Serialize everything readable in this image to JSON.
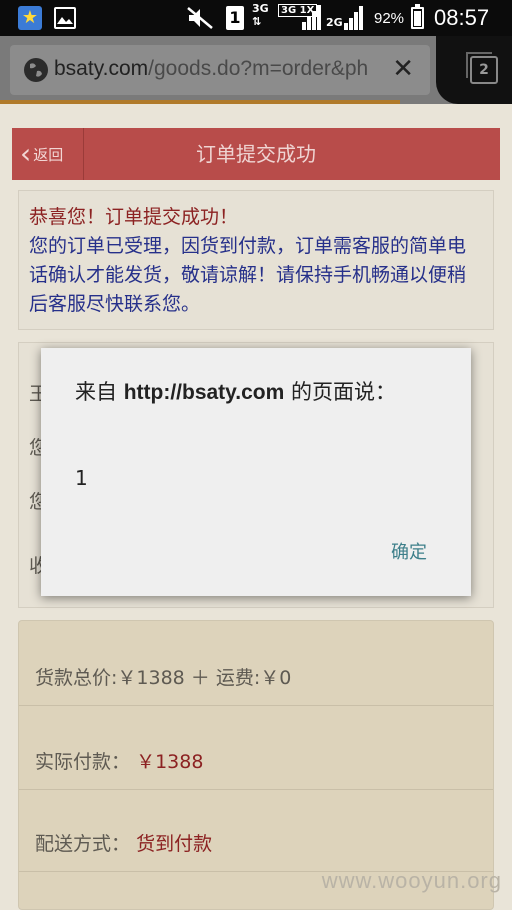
{
  "status_bar": {
    "sim_slot": "1",
    "network_3g": "3G",
    "network_3g_1x": "3G 1X",
    "network_2g": "2G",
    "battery_percent": "92%",
    "time": "08:57"
  },
  "browser": {
    "url_domain": "bsaty.com",
    "url_path": "/goods.do?m=order&ph",
    "tab_count": "2"
  },
  "page": {
    "back_label": "返回",
    "title": "订单提交成功",
    "success_heading": "恭喜您！订单提交成功！",
    "success_body": "您的订单已受理，因货到付款，订单需客服的简单电话确认才能发货，敬请谅解！请保持手机畅通以便稍后客服尽快联系您。",
    "info_rows": [
      "王",
      "您",
      "您",
      "收"
    ],
    "totals": {
      "goods_and_shipping": "货款总价:￥1388 ＋ 运费:￥0",
      "actual_payment_label": "实际付款：",
      "actual_payment_value": "￥1388",
      "delivery_label": "配送方式：",
      "delivery_value": "货到付款"
    },
    "watermark": "www.wooyun.org"
  },
  "dialog": {
    "title_prefix": "来自",
    "title_origin": "http://bsaty.com",
    "title_suffix": "的页面说：",
    "message": "1",
    "ok_label": "确定"
  }
}
